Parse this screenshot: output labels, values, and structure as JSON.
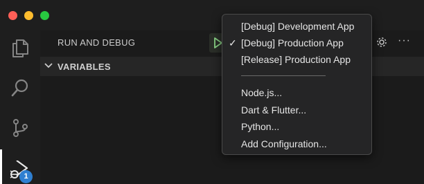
{
  "sidebar": {
    "title": "RUN AND DEBUG",
    "section_label": "VARIABLES",
    "badge_count": "1",
    "more_label": "···"
  },
  "activity_bar": {
    "items": [
      {
        "icon": "files-icon",
        "active": false
      },
      {
        "icon": "search-icon",
        "active": false
      },
      {
        "icon": "source-control-icon",
        "active": false
      },
      {
        "icon": "run-debug-icon",
        "active": true
      }
    ]
  },
  "dropdown": {
    "items": [
      {
        "label": "[Debug] Development App",
        "checked": false
      },
      {
        "label": "[Debug] Production App",
        "checked": true
      },
      {
        "label": "[Release] Production App",
        "checked": false
      }
    ],
    "check_mark": "✓",
    "config_items": [
      {
        "label": "Node.js..."
      },
      {
        "label": "Dart & Flutter..."
      },
      {
        "label": "Python..."
      },
      {
        "label": "Add Configuration..."
      }
    ]
  },
  "colors": {
    "background": "#1e1e1e",
    "panel": "#1b1b1b",
    "play_icon": "#89d185",
    "badge": "#2f7fd1",
    "traffic_close": "#ff5f57",
    "traffic_min": "#febc2e",
    "traffic_max": "#28c840"
  }
}
